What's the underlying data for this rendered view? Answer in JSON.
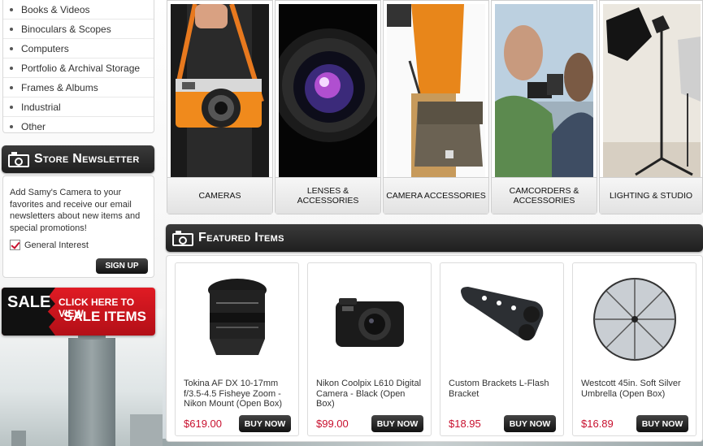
{
  "categories": {
    "items": [
      {
        "label": "Books & Videos"
      },
      {
        "label": "Binoculars & Scopes"
      },
      {
        "label": "Computers"
      },
      {
        "label": "Portfolio & Archival Storage"
      },
      {
        "label": "Frames & Albums"
      },
      {
        "label": "Industrial"
      },
      {
        "label": "Other"
      }
    ]
  },
  "newsletter": {
    "title": "Store Newsletter",
    "text": "Add Samy's Camera to your favorites and receive our email newsletters about new items and special promotions!",
    "checkbox_label": "General Interest",
    "checkbox_checked": true,
    "button_label": "SIGN UP"
  },
  "sale_banner": {
    "word": "SALE",
    "line1": "CLICK HERE TO VIEW",
    "line2": "SALE ITEMS"
  },
  "category_tiles": [
    {
      "label": "CAMERAS"
    },
    {
      "label": "LENSES & ACCESSORIES"
    },
    {
      "label": "CAMERA ACCESSORIES"
    },
    {
      "label": "CAMCORDERS & ACCESSORIES"
    },
    {
      "label": "LIGHTING & STUDIO"
    }
  ],
  "featured": {
    "title": "Featured Items",
    "buy_label": "BUY NOW",
    "products": [
      {
        "name": "Tokina AF DX 10-17mm f/3.5-4.5 Fisheye Zoom - Nikon Mount (Open Box)",
        "price": "$619.00"
      },
      {
        "name": "Nikon Coolpix L610 Digital Camera - Black (Open Box)",
        "price": "$99.00"
      },
      {
        "name": "Custom Brackets L-Flash Bracket",
        "price": "$18.95"
      },
      {
        "name": "Westcott 45in. Soft Silver Umbrella (Open Box)",
        "price": "$16.89"
      }
    ]
  },
  "colors": {
    "accent_red": "#c8102e",
    "header_dark": "#1f1f1f"
  }
}
